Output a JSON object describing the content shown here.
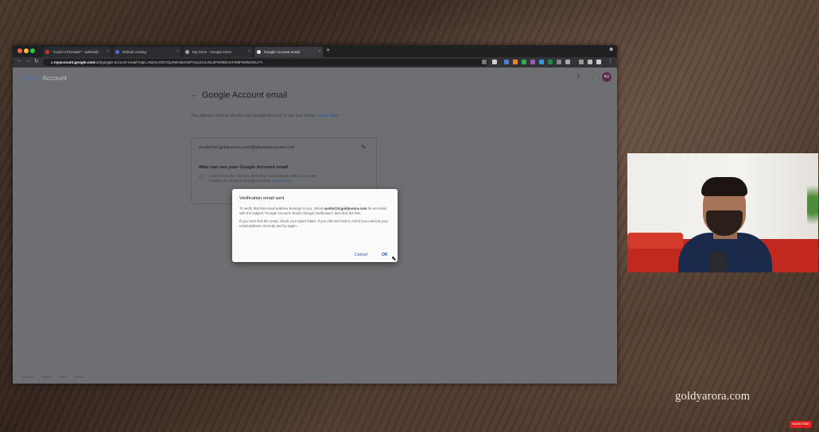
{
  "browser": {
    "tabs": [
      {
        "label": "\"Catch All Emails\" - admin@...",
        "active": false
      },
      {
        "label": "Default routing",
        "active": false
      },
      {
        "label": "My Drive - Google Drive",
        "active": false
      },
      {
        "label": "Google Account email",
        "active": true
      }
    ],
    "new_tab": "+",
    "url_host": "myaccount.google.com",
    "url_path": "/u/3/google-account-email?rapt=AEjHL4OD7dyJNKABcNWTvQLk1UvDL2PSNBEUAF3MFNMW2SU7Y..."
  },
  "account_page": {
    "logo_google": "Google",
    "logo_account": "Account",
    "avatar_initials": "AU",
    "title": "Google Account email",
    "description": "The address used to identify your Google Account to you and others.",
    "learn_more": "Learn more",
    "email": "austin%d.goldyarora.com@gtempaccount.com",
    "who_title": "Who can see your Google Account email",
    "who_desc": "Anyone can see this info when they communicate with you or view content you create in Google services.",
    "who_learn_more": "Learn more",
    "footer_links": [
      "Privacy",
      "Terms",
      "Help",
      "About"
    ]
  },
  "dialog": {
    "title": "Verification email sent",
    "para1_a": "To verify that this email address belongs to you, check",
    "para1_email": "austin@d.goldyarora.com",
    "para1_b": "for an email with the subject \"Google Account: Email Change Verification\" and click the link.",
    "para2": "If you can't find the email, check your spam folder. If you still can't find it, check you entered your email address correctly and try again.",
    "cancel_label": "Cancel",
    "ok_label": "OK"
  },
  "watermark": "goldyarora.com",
  "channel_badge": "SUBSCRIBE"
}
